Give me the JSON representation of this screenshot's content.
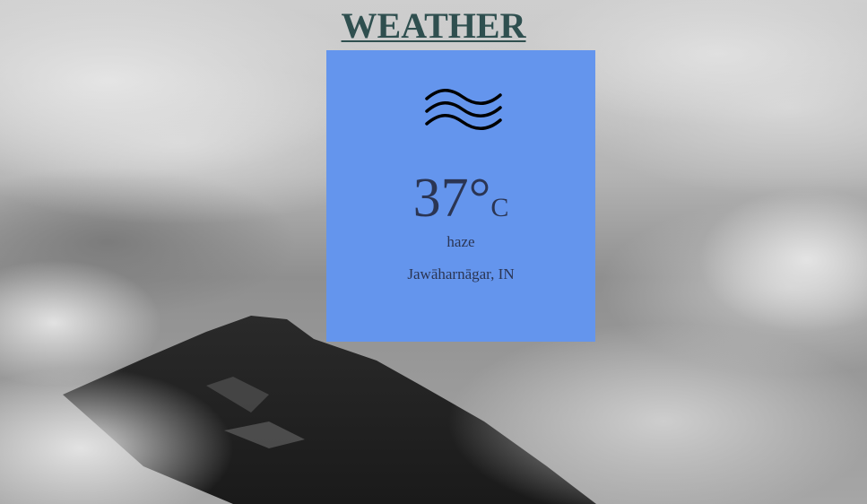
{
  "header": {
    "title": "WEATHER"
  },
  "weather": {
    "icon": "haze-icon",
    "temperature": "37°",
    "unit": "C",
    "description": "haze",
    "location": "Jawāharnāgar, IN"
  },
  "colors": {
    "card_background": "#6495ed",
    "title_color": "#2f4f4f",
    "text_color": "#2b3553"
  }
}
